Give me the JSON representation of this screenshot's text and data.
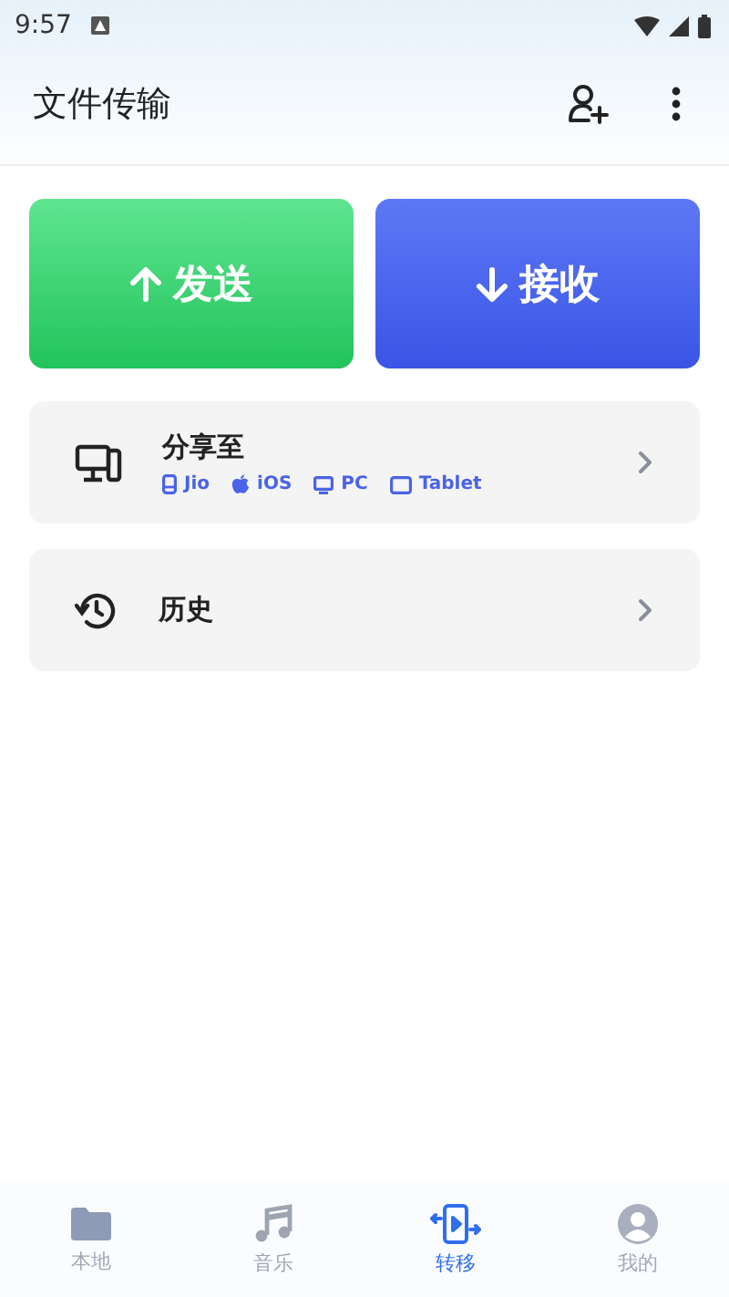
{
  "status_bar": {
    "time": "9:57"
  },
  "app_bar": {
    "title": "文件传输"
  },
  "actions": [
    {
      "kind": "send",
      "label": "发送"
    },
    {
      "kind": "receive",
      "label": "接收"
    }
  ],
  "menu": [
    {
      "kind": "share",
      "title": "分享至",
      "targets": [
        {
          "kind": "phone",
          "label": "Jio"
        },
        {
          "kind": "apple",
          "label": "iOS"
        },
        {
          "kind": "pc",
          "label": "PC"
        },
        {
          "kind": "tablet",
          "label": "Tablet"
        }
      ]
    },
    {
      "kind": "history",
      "title": "历史"
    }
  ],
  "bottom_nav": [
    {
      "kind": "folder",
      "label": "本地",
      "selected": false
    },
    {
      "kind": "music",
      "label": "音乐",
      "selected": false
    },
    {
      "kind": "transfer",
      "label": "转移",
      "selected": true
    },
    {
      "kind": "profile",
      "label": "我的",
      "selected": false
    }
  ]
}
